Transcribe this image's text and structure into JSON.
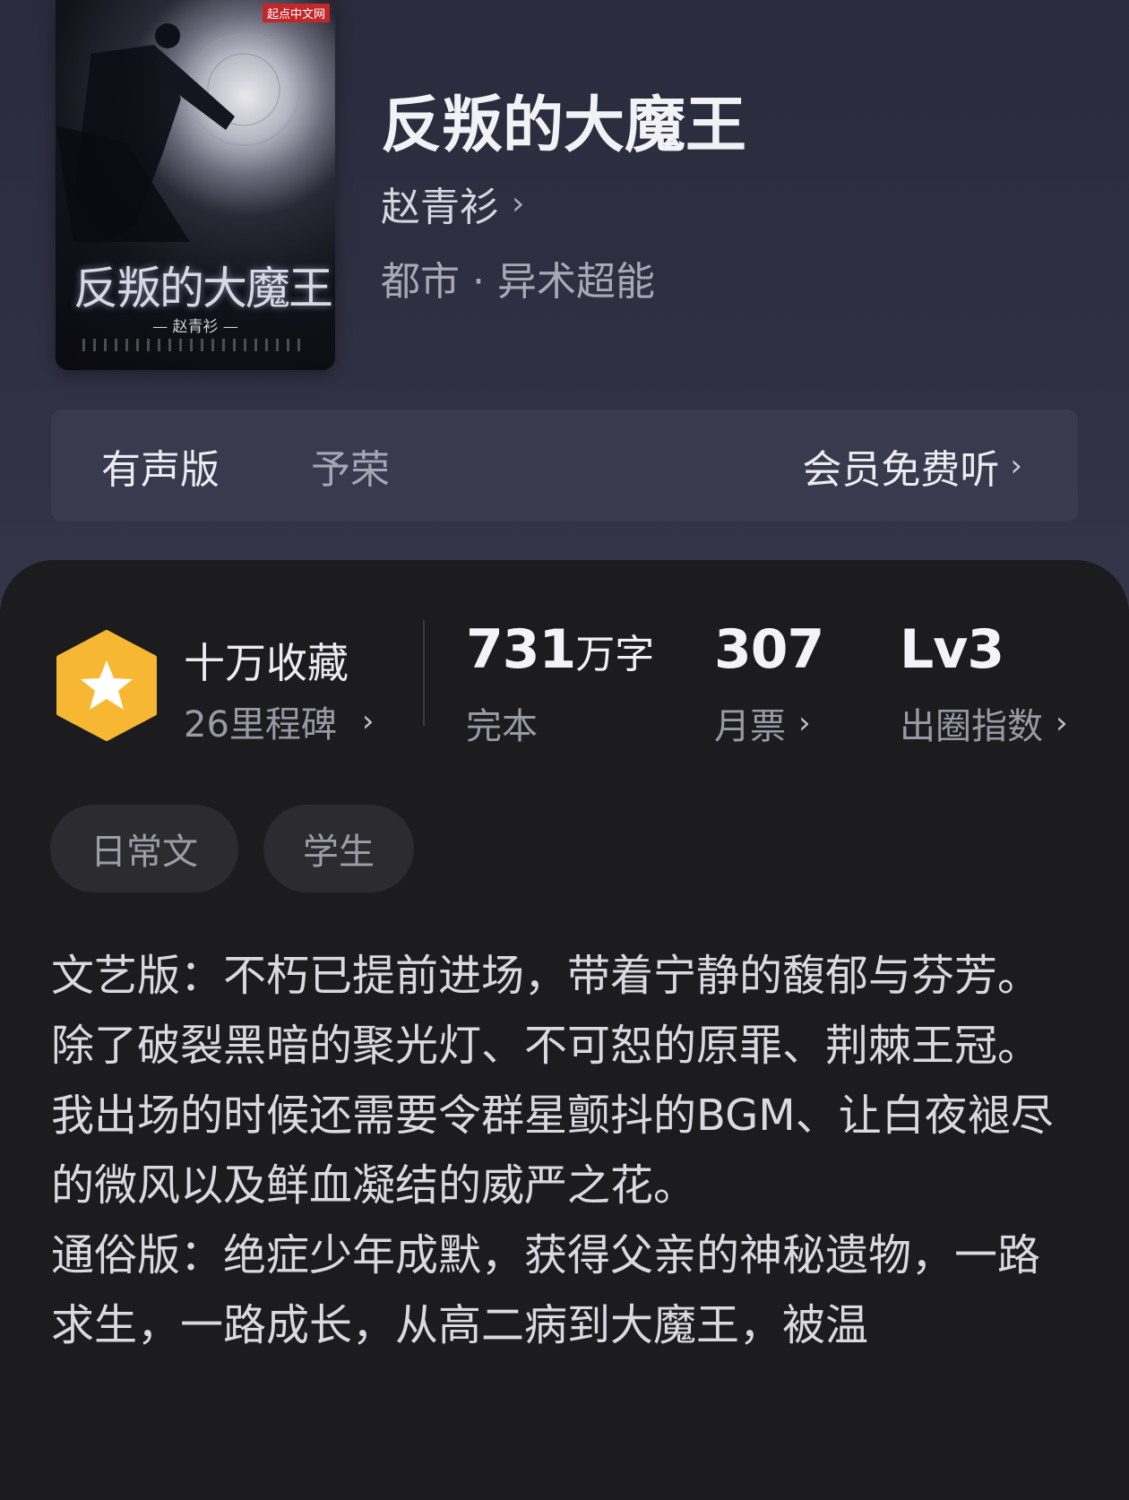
{
  "cover": {
    "publisher": "起点中文网",
    "title": "反叛的大魔王",
    "author": "— 赵青衫 —"
  },
  "book": {
    "title": "反叛的大魔王",
    "author": "赵青衫",
    "genre": "都市 · 异术超能"
  },
  "audio": {
    "label": "有声版",
    "narrator": "予荣",
    "action": "会员免费听"
  },
  "stats": {
    "milestone_title": "十万收藏",
    "milestone_sub": "26里程碑",
    "words_value": "731",
    "words_unit": "万字",
    "words_sub": "完本",
    "votes_value": "307",
    "votes_sub": "月票",
    "level_value": "Lv3",
    "level_sub": "出圈指数"
  },
  "tags": [
    "日常文",
    "学生"
  ],
  "synopsis": [
    "文艺版：不朽已提前进场，带着宁静的馥郁与芬芳。",
    "除了破裂黑暗的聚光灯、不可恕的原罪、荆棘王冠。",
    "我出场的时候还需要令群星颤抖的BGM、让白夜褪尽的微风以及鲜血凝结的威严之花。",
    "通俗版：绝症少年成默，获得父亲的神秘遗物，一路求生，一路成长，从高二病到大魔王，被温"
  ],
  "colors": {
    "badge": "#f7b733",
    "hero_bg": "#2f2f42",
    "card_bg": "#1c1c1f"
  }
}
